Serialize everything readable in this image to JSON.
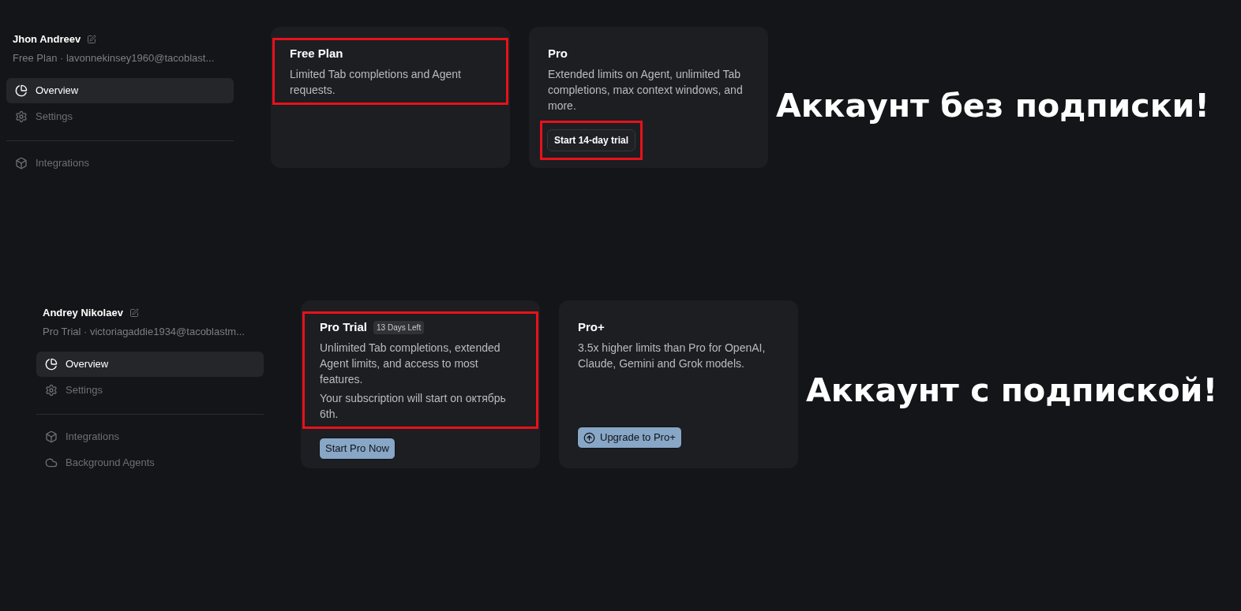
{
  "panels": [
    {
      "user": {
        "name": "Jhon Andreev",
        "subtitle": "Free Plan · lavonnekinsey1960@tacoblast..."
      },
      "nav_groups": [
        [
          {
            "label": "Overview",
            "kind": "overview",
            "selected": true
          },
          {
            "label": "Settings",
            "kind": "settings",
            "selected": false
          }
        ],
        [
          {
            "label": "Integrations",
            "kind": "integrations",
            "selected": false
          }
        ]
      ],
      "plans": [
        {
          "title": "Free Plan",
          "description": [
            "Limited Tab completions and Agent requests."
          ],
          "highlighted": true
        },
        {
          "title": "Pro",
          "description": [
            "Extended limits on Agent, unlimited Tab completions, max context windows, and more."
          ],
          "highlighted": false,
          "button": {
            "label": "Start 14-day trial",
            "kind": "outline",
            "highlighted": true
          }
        }
      ],
      "caption": "Аккаунт без подписки!"
    },
    {
      "user": {
        "name": "Andrey Nikolaev",
        "subtitle": "Pro Trial · victoriagaddie1934@tacoblastm..."
      },
      "nav_groups": [
        [
          {
            "label": "Overview",
            "kind": "overview",
            "selected": true
          },
          {
            "label": "Settings",
            "kind": "settings",
            "selected": false
          }
        ],
        [
          {
            "label": "Integrations",
            "kind": "integrations",
            "selected": false
          },
          {
            "label": "Background Agents",
            "kind": "agents",
            "selected": false
          }
        ]
      ],
      "plans": [
        {
          "title": "Pro Trial",
          "badge": "13 Days Left",
          "description": [
            "Unlimited Tab completions, extended Agent limits, and access to most features.",
            "Your subscription will start on октябрь 6th."
          ],
          "highlighted": true,
          "button": {
            "label": "Start Pro Now",
            "kind": "primary",
            "highlighted": false
          }
        },
        {
          "title": "Pro+",
          "description": [
            "3.5x higher limits than Pro for OpenAI, Claude, Gemini and Grok models."
          ],
          "highlighted": false,
          "button": {
            "label": "Upgrade to Pro+",
            "kind": "upgrade",
            "highlighted": false
          }
        }
      ],
      "caption": "Аккаунт с подпиской!"
    }
  ]
}
